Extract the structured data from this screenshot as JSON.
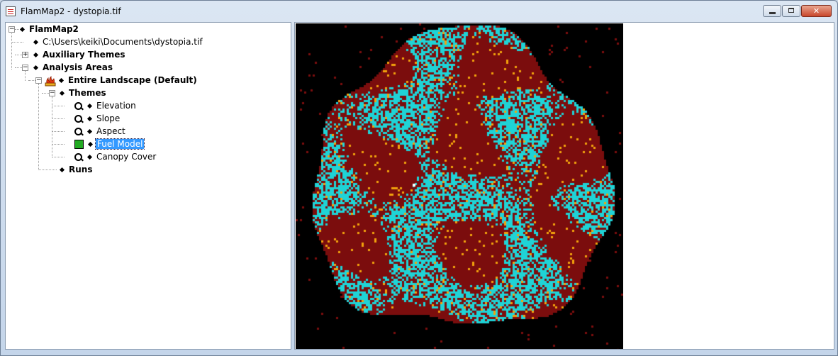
{
  "window": {
    "title": "FlamMap2 - dystopia.tif",
    "min_glyph": "",
    "max_glyph": "",
    "close_glyph": "✕"
  },
  "tree": {
    "root": "FlamMap2",
    "file_path": "C:\\Users\\keiki\\Documents\\dystopia.tif",
    "auxiliary_themes": "Auxiliary Themes",
    "analysis_areas": "Analysis Areas",
    "entire_landscape": "Entire Landscape (Default)",
    "themes": "Themes",
    "elevation": "Elevation",
    "slope": "Slope",
    "aspect": "Aspect",
    "fuel_model": "Fuel Model",
    "canopy_cover": "Canopy Cover",
    "runs": "Runs",
    "selected": "Fuel Model"
  },
  "map": {
    "colors": {
      "background": "#000000",
      "dominant": "#7b0d0d",
      "cyan": "#1fd3d6",
      "orange": "#f2a20c",
      "white": "#ffffff"
    }
  }
}
